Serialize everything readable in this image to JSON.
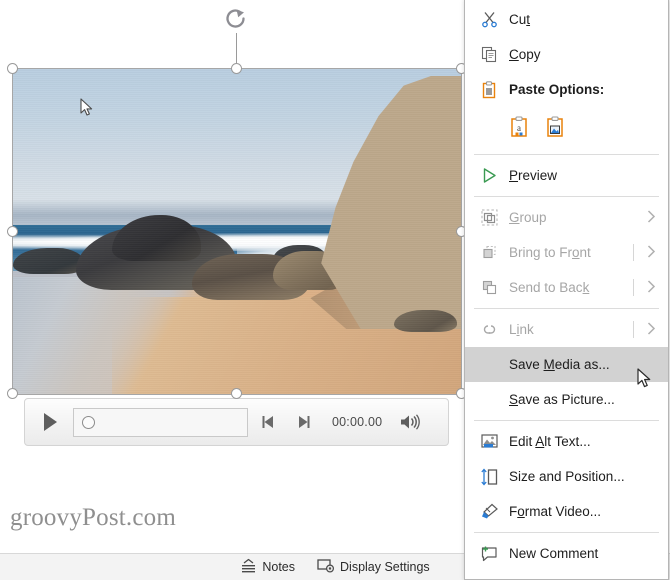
{
  "app": {
    "watermark": "groovyPost.com"
  },
  "media": {
    "play_label": "Play",
    "rewind_label": "Move Back 0.25 Seconds",
    "forward_label": "Move Forward 0.25 Seconds",
    "time": "00:00.00",
    "volume_label": "Mute/Unmute",
    "icons": {
      "play": "play-icon",
      "rewind": "step-back-icon",
      "forward": "step-forward-icon",
      "volume": "volume-icon",
      "knob": "progress-knob"
    }
  },
  "selection": {
    "rotate_icon": "rotate-handle-icon",
    "handle_icon": "resize-handle-icon"
  },
  "statusbar": {
    "notes": "Notes",
    "display_settings": "Display Settings",
    "notes_icon": "notes-icon",
    "display_icon": "display-settings-icon"
  },
  "context_menu": {
    "items": [
      {
        "id": "cut",
        "label": "Cut",
        "accel_before": "Cu",
        "accel": "t",
        "accel_after": "",
        "icon": "scissors-icon",
        "disabled": false,
        "highlight": false,
        "submenu": false
      },
      {
        "id": "copy",
        "label": "Copy",
        "accel_before": "",
        "accel": "C",
        "accel_after": "opy",
        "icon": "copy-icon",
        "disabled": false,
        "highlight": false,
        "submenu": false
      },
      {
        "id": "paste-options",
        "label": "Paste Options:",
        "icon": "clipboard-icon",
        "disabled": false,
        "highlight": false,
        "submenu": false,
        "bold": true
      },
      {
        "id": "preview",
        "label": "Preview",
        "accel_before": "",
        "accel": "P",
        "accel_after": "review",
        "icon": "preview-play-icon",
        "disabled": false,
        "highlight": false,
        "submenu": false
      },
      {
        "id": "group",
        "label": "Group",
        "accel_before": "",
        "accel": "G",
        "accel_after": "roup",
        "icon": "group-icon",
        "disabled": true,
        "highlight": false,
        "submenu": true
      },
      {
        "id": "bring-to-front",
        "label": "Bring to Front",
        "accel_before": "Bring to Fr",
        "accel": "o",
        "accel_after": "nt",
        "icon": "bring-front-icon",
        "disabled": true,
        "highlight": false,
        "submenu": true
      },
      {
        "id": "send-to-back",
        "label": "Send to Back",
        "accel_before": "Send to Bac",
        "accel": "k",
        "accel_after": "",
        "icon": "send-back-icon",
        "disabled": true,
        "highlight": false,
        "submenu": true
      },
      {
        "id": "link",
        "label": "Link",
        "accel_before": "L",
        "accel": "i",
        "accel_after": "nk",
        "icon": "link-icon",
        "disabled": true,
        "highlight": false,
        "submenu": true
      },
      {
        "id": "save-media-as",
        "label": "Save Media as...",
        "accel_before": "Save ",
        "accel": "M",
        "accel_after": "edia as...",
        "icon": "",
        "disabled": false,
        "highlight": true,
        "submenu": false
      },
      {
        "id": "save-as-picture",
        "label": "Save as Picture...",
        "accel_before": "",
        "accel": "S",
        "accel_after": "ave as Picture...",
        "icon": "",
        "disabled": false,
        "highlight": false,
        "submenu": false
      },
      {
        "id": "edit-alt-text",
        "label": "Edit Alt Text...",
        "accel_before": "Edit ",
        "accel": "A",
        "accel_after": "lt Text...",
        "icon": "alt-text-icon",
        "disabled": false,
        "highlight": false,
        "submenu": false
      },
      {
        "id": "size-and-position",
        "label": "Size and Position...",
        "accel_before": "Size and Position...",
        "accel": "",
        "accel_after": "",
        "icon": "size-position-icon",
        "disabled": false,
        "highlight": false,
        "submenu": false
      },
      {
        "id": "format-video",
        "label": "Format Video...",
        "accel_before": "F",
        "accel": "o",
        "accel_after": "rmat Video...",
        "icon": "format-video-icon",
        "disabled": false,
        "highlight": false,
        "submenu": false
      },
      {
        "id": "new-comment",
        "label": "New Comment",
        "accel_before": "New Comment",
        "accel": "",
        "accel_after": "",
        "icon": "new-comment-icon",
        "disabled": false,
        "highlight": false,
        "submenu": false
      }
    ],
    "paste_options": [
      {
        "id": "paste-keep-text-only",
        "label": "Keep Text Only",
        "icon": "paste-text-icon"
      },
      {
        "id": "paste-picture",
        "label": "Picture",
        "icon": "paste-picture-icon"
      }
    ],
    "colors": {
      "highlight": "#d2d2d2",
      "accent_orange": "#e8820c",
      "accent_blue": "#2b7cd3",
      "accent_green": "#3a9a52",
      "border": "#b5b5b5"
    }
  }
}
